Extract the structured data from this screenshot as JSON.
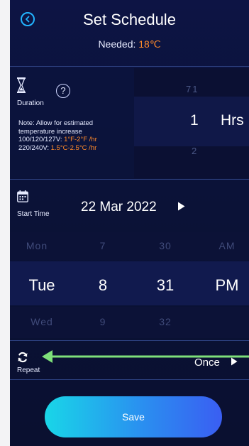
{
  "header": {
    "title": "Set Schedule",
    "needed_label": "Needed: ",
    "needed_value": "18℃"
  },
  "duration": {
    "label": "Duration",
    "note_line1": "Note: Allow for estimated",
    "note_line2": "temperature increase",
    "note_120_label": "100/120/127V: ",
    "note_120_value": "1°F-2°F /hr",
    "note_240_label": "220/240V: ",
    "note_240_value": "1.5°C-2.5°C /hr",
    "wheel_prev": "71",
    "wheel_value": "1",
    "wheel_next": "2",
    "unit": "Hrs"
  },
  "start_time": {
    "label": "Start Time",
    "date": "22 Mar 2022"
  },
  "time_picker": {
    "day_prev": "Mon",
    "day": "Tue",
    "day_next": "Wed",
    "hour_prev": "7",
    "hour": "8",
    "hour_next": "9",
    "minute_prev": "30",
    "minute": "31",
    "minute_next": "32",
    "ampm_prev": "AM",
    "ampm": "PM"
  },
  "repeat": {
    "label": "Repeat",
    "value": "Once"
  },
  "save_label": "Save",
  "colors": {
    "accent_orange": "#ff8a2a",
    "link_blue": "#22b4ff",
    "annotation_green": "#7ee07a",
    "background_navy": "#0b1238"
  }
}
